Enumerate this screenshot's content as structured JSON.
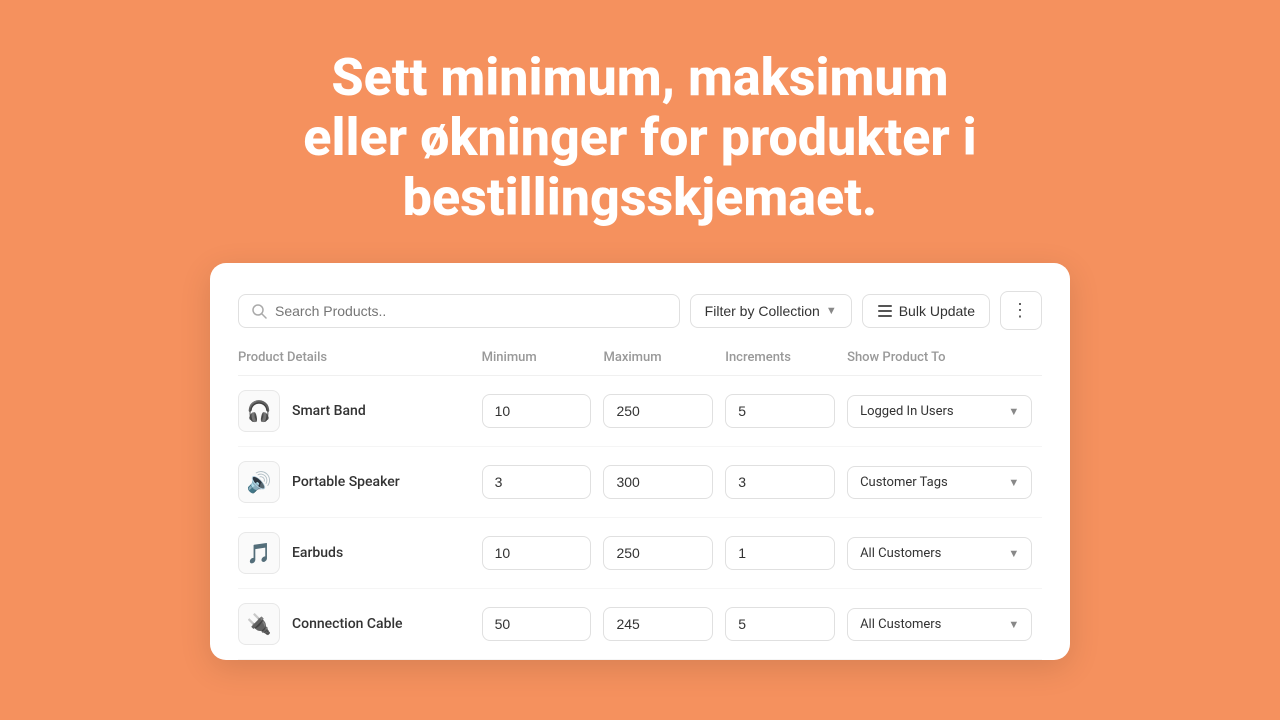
{
  "hero": {
    "text": "Sett minimum, maksimum eller økninger for produkter i bestillingsskjemaet."
  },
  "toolbar": {
    "search_placeholder": "Search Products..",
    "filter_label": "Filter by Collection",
    "bulk_label": "Bulk Update"
  },
  "table": {
    "headers": {
      "product": "Product Details",
      "minimum": "Minimum",
      "maximum": "Maximum",
      "increments": "Increments",
      "show": "Show Product To"
    },
    "rows": [
      {
        "name": "Smart Band",
        "icon": "🎧",
        "minimum": "10",
        "maximum": "250",
        "increments": "5",
        "show": "Logged In Users"
      },
      {
        "name": "Portable Speaker",
        "icon": "🔊",
        "minimum": "3",
        "maximum": "300",
        "increments": "3",
        "show": "Customer Tags"
      },
      {
        "name": "Earbuds",
        "icon": "🎵",
        "minimum": "10",
        "maximum": "250",
        "increments": "1",
        "show": "All Customers"
      },
      {
        "name": "Connection Cable",
        "icon": "🔌",
        "minimum": "50",
        "maximum": "245",
        "increments": "5",
        "show": "All Customers"
      }
    ]
  }
}
